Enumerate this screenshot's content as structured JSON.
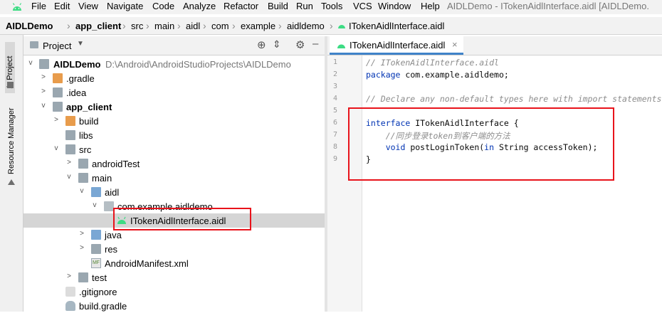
{
  "menubar": {
    "items": [
      "File",
      "Edit",
      "View",
      "Navigate",
      "Code",
      "Analyze",
      "Refactor",
      "Build",
      "Run",
      "Tools",
      "VCS",
      "Window",
      "Help"
    ],
    "window_title": "AIDLDemo - ITokenAidlInterface.aidl [AIDLDemo.",
    "logo_icon": "android-icon"
  },
  "breadcrumb": {
    "items": [
      "AIDLDemo",
      "app_client",
      "src",
      "main",
      "aidl",
      "com",
      "example",
      "aidldemo",
      "ITokenAidlInterface.aidl"
    ]
  },
  "left_strip": {
    "project_tab": "1: Project",
    "resource_tab": "Resource Manager"
  },
  "project_panel": {
    "title": "Project",
    "dropdown_icon": "chevron-down-icon",
    "tools": [
      "locate-icon",
      "collapse-icon",
      "settings-icon",
      "hide-icon"
    ],
    "tree": [
      {
        "label": "AIDLDemo",
        "path": "D:\\Android\\AndroidStudioProjects\\AIDLDemo",
        "expanded": "v",
        "icon": "module-icon"
      },
      {
        "label": ".gradle",
        "expanded": ">",
        "icon": "folder-orange-icon"
      },
      {
        "label": ".idea",
        "expanded": ">",
        "icon": "folder-icon"
      },
      {
        "label": "app_client",
        "expanded": "v",
        "icon": "module-icon"
      },
      {
        "label": "build",
        "expanded": ">",
        "icon": "folder-orange-icon"
      },
      {
        "label": "libs",
        "expanded": "",
        "icon": "folder-icon"
      },
      {
        "label": "src",
        "expanded": "v",
        "icon": "folder-icon"
      },
      {
        "label": "androidTest",
        "expanded": ">",
        "icon": "folder-icon"
      },
      {
        "label": "main",
        "expanded": "v",
        "icon": "folder-icon"
      },
      {
        "label": "aidl",
        "expanded": "v",
        "icon": "folder-blue-icon"
      },
      {
        "label": "com.example.aidldemo",
        "expanded": "v",
        "icon": "package-icon"
      },
      {
        "label": "ITokenAidlInterface.aidl",
        "expanded": "",
        "icon": "android-file-icon"
      },
      {
        "label": "java",
        "expanded": ">",
        "icon": "folder-blue-icon"
      },
      {
        "label": "res",
        "expanded": ">",
        "icon": "folder-icon"
      },
      {
        "label": "AndroidManifest.xml",
        "expanded": "",
        "icon": "manifest-icon"
      },
      {
        "label": "test",
        "expanded": ">",
        "icon": "folder-icon"
      },
      {
        "label": ".gitignore",
        "expanded": "",
        "icon": "gitignore-icon"
      },
      {
        "label": "build.gradle",
        "expanded": "",
        "icon": "gradle-icon"
      }
    ]
  },
  "editor": {
    "tab_label": "ITokenAidlInterface.aidl",
    "tab_close": "×",
    "line_numbers": [
      "1",
      "2",
      "3",
      "4",
      "5",
      "6",
      "7",
      "8",
      "9"
    ],
    "code": {
      "l1": "// ITokenAidlInterface.aidl",
      "l2_kw": "package",
      "l2_rest": " com.example.aidldemo;",
      "l4": "// Declare any non-default types here with import statements",
      "l6_kw": "interface",
      "l6_rest": " ITokenAidlInterface {",
      "l7": "    //同步登录token到客户端的方法",
      "l8_kw": "    void",
      "l8_mid": " postLoginToken(",
      "l8_in": "in",
      "l8_rest": " String accessToken);",
      "l9": "}"
    }
  },
  "colors": {
    "highlight_border": "#e8131b",
    "selection": "#d5d5d5",
    "keyword": "#0033b3",
    "comment": "#8c8c8c"
  }
}
